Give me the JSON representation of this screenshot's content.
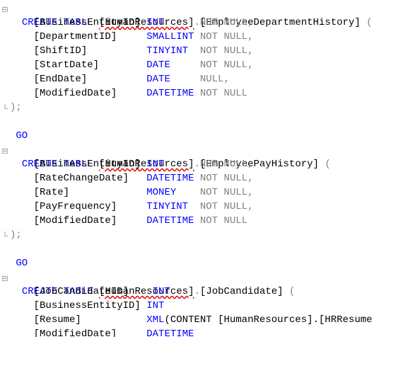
{
  "fold": {
    "collapsed": "⊟",
    "mid": "│",
    "end": "└"
  },
  "kw_create": "CREATE",
  "kw_table": "TABLE",
  "kw_go": "GO",
  "schema": "[HumanResources]",
  "tables": [
    {
      "name": "[EmployeeDepartmentHistory]",
      "columns": [
        {
          "name": "[BusinessEntityID]",
          "type": "INT",
          "null": "NOT NULL,"
        },
        {
          "name": "[DepartmentID]",
          "type": "SMALLINT",
          "null": "NOT NULL,"
        },
        {
          "name": "[ShiftID]",
          "type": "TINYINT",
          "null": "NOT NULL,"
        },
        {
          "name": "[StartDate]",
          "type": "DATE",
          "null": "NOT NULL,"
        },
        {
          "name": "[EndDate]",
          "type": "DATE",
          "null": "NULL,"
        },
        {
          "name": "[ModifiedDate]",
          "type": "DATETIME",
          "null": "NOT NULL"
        }
      ],
      "closing": ");",
      "go": "GO"
    },
    {
      "name": "[EmployeePayHistory]",
      "columns": [
        {
          "name": "[BusinessEntityID]",
          "type": "INT",
          "null": "NOT NULL,"
        },
        {
          "name": "[RateChangeDate]",
          "type": "DATETIME",
          "null": "NOT NULL,"
        },
        {
          "name": "[Rate]",
          "type": "MONEY",
          "null": "NOT NULL,"
        },
        {
          "name": "[PayFrequency]",
          "type": "TINYINT",
          "null": "NOT NULL,"
        },
        {
          "name": "[ModifiedDate]",
          "type": "DATETIME",
          "null": "NOT NULL"
        }
      ],
      "closing": ");",
      "go": "GO"
    },
    {
      "name": "[JobCandidate]",
      "columns": [
        {
          "name": "[JobCandidateID]",
          "type": "INT",
          "null": ""
        },
        {
          "name": "[BusinessEntityID]",
          "type": "INT",
          "null": ""
        },
        {
          "name": "[Resume]",
          "type_prefix": "XML",
          "type_rest": "(CONTENT [HumanResources].[HRResume",
          "null": ""
        },
        {
          "name": "[ModifiedDate]",
          "type": "DATETIME",
          "null": ""
        }
      ]
    }
  ],
  "colwidths": {
    "indent": "    ",
    "name_pad": 19,
    "type_pad": 9
  }
}
